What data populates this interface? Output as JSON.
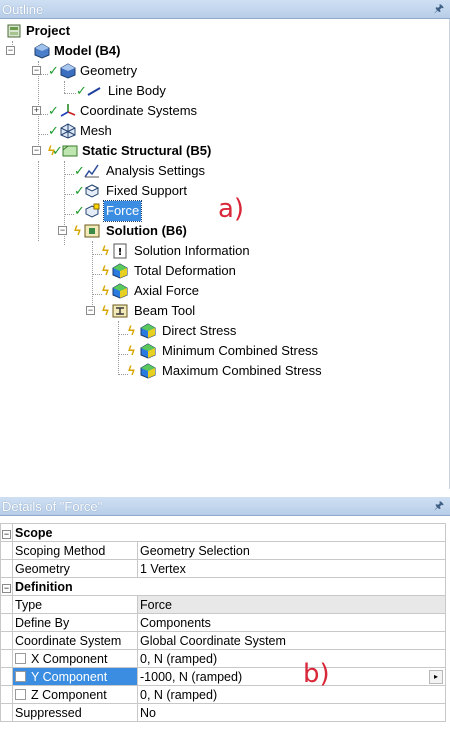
{
  "outline": {
    "title": "Outline",
    "pin_icon": "pin-icon",
    "nodes": [
      {
        "label": "Project",
        "icon": "project-icon",
        "bold": true
      },
      {
        "label": "Model (B4)",
        "icon": "model-icon",
        "bold": true
      },
      {
        "label": "Geometry",
        "icon": "geometry-icon"
      },
      {
        "label": "Line Body",
        "icon": "line-body-icon"
      },
      {
        "label": "Coordinate Systems",
        "icon": "coordinate-systems-icon"
      },
      {
        "label": "Mesh",
        "icon": "mesh-icon"
      },
      {
        "label": "Static Structural (B5)",
        "icon": "static-structural-icon",
        "bold": true
      },
      {
        "label": "Analysis Settings",
        "icon": "analysis-settings-icon"
      },
      {
        "label": "Fixed Support",
        "icon": "fixed-support-icon"
      },
      {
        "label": "Force",
        "icon": "force-icon",
        "selected": true
      },
      {
        "label": "Solution (B6)",
        "icon": "solution-icon",
        "bold": true
      },
      {
        "label": "Solution Information",
        "icon": "solution-information-icon"
      },
      {
        "label": "Total Deformation",
        "icon": "result-icon"
      },
      {
        "label": "Axial Force",
        "icon": "result-icon"
      },
      {
        "label": "Beam Tool",
        "icon": "beam-tool-icon"
      },
      {
        "label": "Direct Stress",
        "icon": "result-icon"
      },
      {
        "label": "Minimum Combined Stress",
        "icon": "result-icon"
      },
      {
        "label": "Maximum Combined Stress",
        "icon": "result-icon"
      }
    ],
    "annotation": "a)"
  },
  "details": {
    "title": "Details of \"Force\"",
    "groups": {
      "scope": "Scope",
      "definition": "Definition"
    },
    "rows": {
      "scoping_method": {
        "name": "Scoping Method",
        "value": "Geometry Selection"
      },
      "geometry": {
        "name": "Geometry",
        "value": "1 Vertex"
      },
      "type": {
        "name": "Type",
        "value": "Force"
      },
      "define_by": {
        "name": "Define By",
        "value": "Components"
      },
      "coordinate_system": {
        "name": "Coordinate System",
        "value": "Global Coordinate System"
      },
      "x_component": {
        "name": "X Component",
        "value": "0, N  (ramped)"
      },
      "y_component": {
        "name": "Y Component",
        "value": "-1000, N  (ramped)"
      },
      "z_component": {
        "name": "Z Component",
        "value": "0, N  (ramped)"
      },
      "suppressed": {
        "name": "Suppressed",
        "value": "No"
      }
    },
    "annotation": "b)"
  },
  "colors": {
    "selection": "#3a8de0",
    "annotation": "#d9273a",
    "check": "#1c9a2a",
    "lightning": "#d7a600"
  }
}
